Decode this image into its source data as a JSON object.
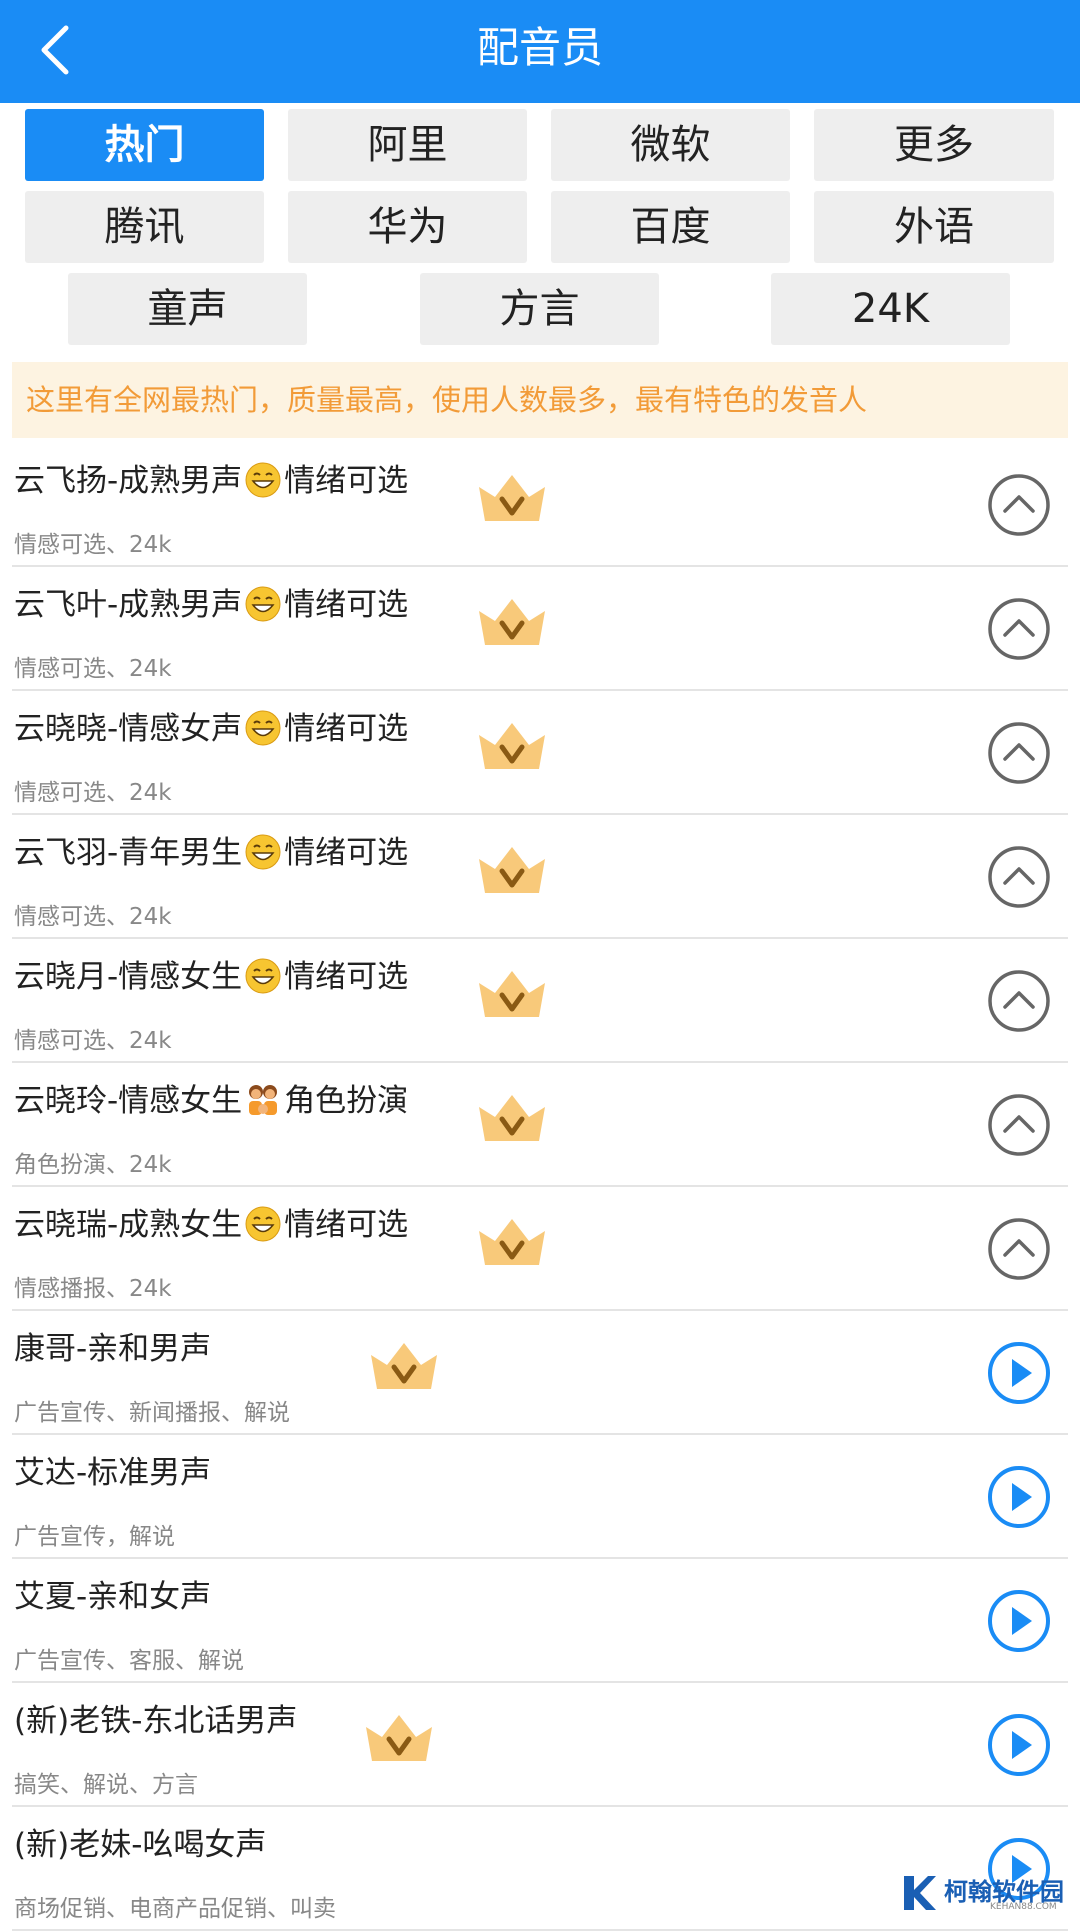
{
  "header": {
    "title": "配音员"
  },
  "tabs": [
    {
      "label": "热门",
      "active": true
    },
    {
      "label": "阿里"
    },
    {
      "label": "微软"
    },
    {
      "label": "更多"
    },
    {
      "label": "腾讯"
    },
    {
      "label": "华为"
    },
    {
      "label": "百度"
    },
    {
      "label": "外语"
    },
    {
      "label": "童声"
    },
    {
      "label": "方言"
    },
    {
      "label": "24K"
    }
  ],
  "notice": "这里有全网最热门，质量最高，使用人数最多，最有特色的发音人",
  "voices": [
    {
      "name_before": "云飞扬-成熟男声",
      "emoji": "grin-emoji",
      "name_after": "情绪可选",
      "tags": "情感可选、24k",
      "vip": true,
      "action": "collapse"
    },
    {
      "name_before": "云飞叶-成熟男声",
      "emoji": "grin-emoji",
      "name_after": "情绪可选",
      "tags": "情感可选、24k",
      "vip": true,
      "action": "collapse"
    },
    {
      "name_before": "云晓晓-情感女声",
      "emoji": "grin-emoji",
      "name_after": "情绪可选",
      "tags": "情感可选、24k",
      "vip": true,
      "action": "collapse"
    },
    {
      "name_before": "云飞羽-青年男生",
      "emoji": "grin-emoji",
      "name_after": "情绪可选",
      "tags": "情感可选、24k",
      "vip": true,
      "action": "collapse"
    },
    {
      "name_before": "云晓月-情感女生",
      "emoji": "grin-emoji",
      "name_after": "情绪可选",
      "tags": "情感可选、24k",
      "vip": true,
      "action": "collapse"
    },
    {
      "name_before": "云晓玲-情感女生",
      "emoji": "family-emoji",
      "name_after": "角色扮演",
      "tags": "角色扮演、24k",
      "vip": true,
      "action": "collapse"
    },
    {
      "name_before": "云晓瑞-成熟女生",
      "emoji": "grin-emoji",
      "name_after": "情绪可选",
      "tags": "情感播报、24k",
      "vip": true,
      "action": "collapse"
    },
    {
      "name_before": "康哥-亲和男声",
      "emoji": "",
      "name_after": "",
      "tags": "广告宣传、新闻播报、解说",
      "vip": true,
      "action": "play"
    },
    {
      "name_before": "艾达-标准男声",
      "emoji": "",
      "name_after": "",
      "tags": "广告宣传，解说",
      "vip": false,
      "action": "play"
    },
    {
      "name_before": "艾夏-亲和女声",
      "emoji": "",
      "name_after": "",
      "tags": "广告宣传、客服、解说",
      "vip": false,
      "action": "play"
    },
    {
      "name_before": "(新)老铁-东北话男声",
      "emoji": "",
      "name_after": "",
      "tags": "搞笑、解说、方言",
      "vip": true,
      "action": "play"
    },
    {
      "name_before": "(新)老妹-吆喝女声",
      "emoji": "",
      "name_after": "",
      "tags": "商场促销、电商产品促销、叫卖",
      "vip": false,
      "action": "play"
    }
  ],
  "watermark": {
    "text": "柯翰软件园",
    "sub": "KEHAN88.COM"
  },
  "colors": {
    "primary": "#1a8cf5",
    "notice_bg": "#fdf3e1",
    "notice_text": "#f29b38",
    "crown": "#f7c36b"
  }
}
